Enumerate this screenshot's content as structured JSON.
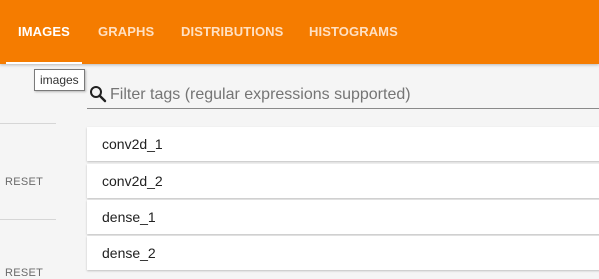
{
  "header": {
    "tabs": [
      {
        "label": "IMAGES",
        "active": true
      },
      {
        "label": "GRAPHS",
        "active": false
      },
      {
        "label": "DISTRIBUTIONS",
        "active": false
      },
      {
        "label": "HISTOGRAMS",
        "active": false
      }
    ],
    "accent_color": "#f57c00"
  },
  "tooltip": {
    "text": "images"
  },
  "sidebar": {
    "reset_labels": [
      "RESET",
      "RESET"
    ]
  },
  "filter": {
    "placeholder": "Filter tags (regular expressions supported)",
    "value": "",
    "icon": "search-icon"
  },
  "tags": [
    {
      "label": "conv2d_1"
    },
    {
      "label": "conv2d_2"
    },
    {
      "label": "dense_1"
    },
    {
      "label": "dense_2"
    }
  ]
}
